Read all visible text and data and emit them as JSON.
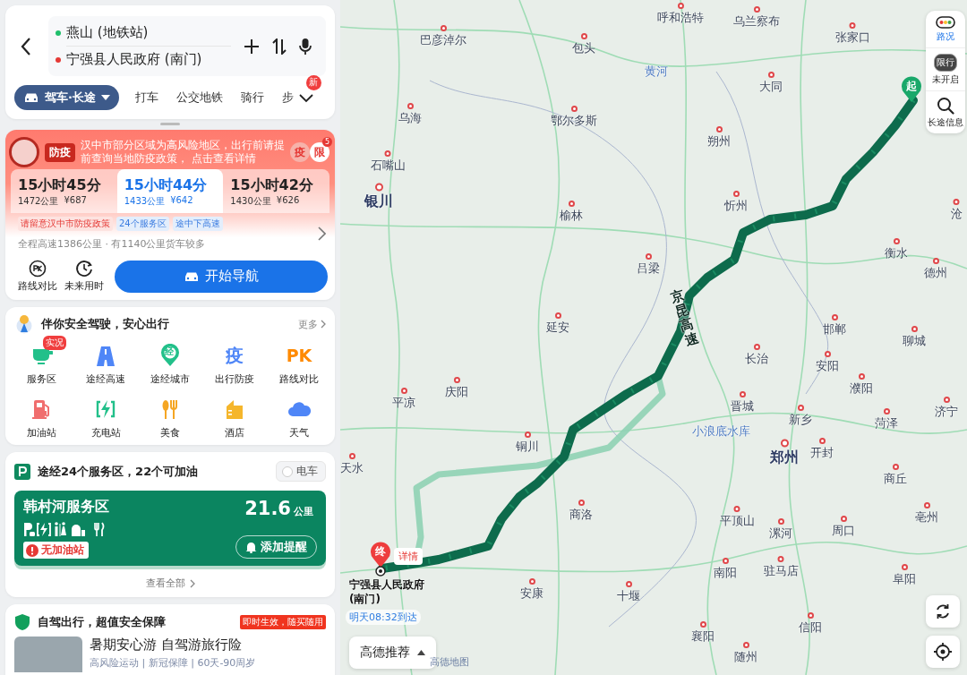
{
  "search": {
    "origin": "燕山 (地铁站)",
    "destination": "宁强县人民政府 (南门)"
  },
  "modes": [
    {
      "label": "驾车·长途",
      "selected": true
    },
    {
      "label": "打车",
      "selected": false
    },
    {
      "label": "公交地铁",
      "selected": false
    },
    {
      "label": "骑行",
      "selected": false
    },
    {
      "label": "步",
      "selected": false
    }
  ],
  "more_modes_badge": "新",
  "epidemic_banner": {
    "tag": "防疫",
    "message": "汉中市部分区域为高风险地区，出行前请提前查询当地防疫政策， 点击查看详情",
    "icons": [
      "疫",
      "限"
    ],
    "count": "5"
  },
  "routes": [
    {
      "duration": "15小时45分",
      "distance": "1472公里",
      "cost": "¥687",
      "selected": false
    },
    {
      "duration": "15小时44分",
      "distance": "1433公里",
      "cost": "¥642",
      "selected": true
    },
    {
      "duration": "15小时42分",
      "distance": "1430公里",
      "cost": "¥626",
      "selected": false
    }
  ],
  "route_tags": [
    {
      "text": "请留意汉中市防疫政策",
      "kind": "warning"
    },
    {
      "text": "24个服务区",
      "kind": "info"
    },
    {
      "text": "途中下高速",
      "kind": "info"
    }
  ],
  "route_summary": "全程高速1386公里 · 有1140公里货车较多",
  "actions": [
    {
      "label": "路线对比",
      "kind": "pk"
    },
    {
      "label": "未来用时",
      "kind": "clock"
    }
  ],
  "start_button": "开始导航",
  "safety": {
    "title": "伴你安全驾驶，安心出行",
    "more": "更多",
    "tools": [
      {
        "label": "服务区",
        "kind": "cup",
        "badge": "实况"
      },
      {
        "label": "途经高速",
        "kind": "road"
      },
      {
        "label": "途经城市",
        "kind": "pin",
        "glyph": "经"
      },
      {
        "label": "出行防疫",
        "kind": "glyph",
        "glyph": "疫"
      },
      {
        "label": "路线对比",
        "kind": "glyph",
        "glyph": "PK"
      },
      {
        "label": "加油站",
        "kind": "fuel"
      },
      {
        "label": "充电站",
        "kind": "charge"
      },
      {
        "label": "美食",
        "kind": "food"
      },
      {
        "label": "酒店",
        "kind": "hotel"
      },
      {
        "label": "天气",
        "kind": "cloud"
      }
    ]
  },
  "service_areas": {
    "title": "途经24个服务区，22个可加油",
    "ev_toggle": {
      "label": "电车",
      "checked": false
    },
    "card": {
      "name": "韩村河服务区",
      "distance": "21.6",
      "unit": "公里",
      "warning": "无加油站",
      "remind": "添加提醒"
    },
    "view_all": "查看全部"
  },
  "insurance": {
    "title": "自驾出行，超值安全保障",
    "badge": "即时生效，随买随用",
    "product": "暑期安心游 自驾游旅行险",
    "features": "高风险运动 | 新冠保障 | 60天-90周岁"
  },
  "map": {
    "places": [
      {
        "name": "呼和浩特",
        "kind": "city"
      },
      {
        "name": "乌兰察布",
        "kind": "city"
      },
      {
        "name": "张家口",
        "kind": "city"
      },
      {
        "name": "巴彦淖尔",
        "kind": "city"
      },
      {
        "name": "包头",
        "kind": "city"
      },
      {
        "name": "黄河",
        "kind": "water"
      },
      {
        "name": "大同",
        "kind": "city"
      },
      {
        "name": "乌海",
        "kind": "city"
      },
      {
        "name": "鄂尔多斯",
        "kind": "city"
      },
      {
        "name": "朔州",
        "kind": "city"
      },
      {
        "name": "石嘴山",
        "kind": "city"
      },
      {
        "name": "银川",
        "kind": "capital"
      },
      {
        "name": "忻州",
        "kind": "city"
      },
      {
        "name": "榆林",
        "kind": "city"
      },
      {
        "name": "沧",
        "kind": "city"
      },
      {
        "name": "吕梁",
        "kind": "city"
      },
      {
        "name": "衡水",
        "kind": "city"
      },
      {
        "name": "德州",
        "kind": "city"
      },
      {
        "name": "延安",
        "kind": "city"
      },
      {
        "name": "邯郸",
        "kind": "city"
      },
      {
        "name": "聊城",
        "kind": "city"
      },
      {
        "name": "长治",
        "kind": "city"
      },
      {
        "name": "安阳",
        "kind": "city"
      },
      {
        "name": "濮阳",
        "kind": "city"
      },
      {
        "name": "庆阳",
        "kind": "city"
      },
      {
        "name": "平凉",
        "kind": "city"
      },
      {
        "name": "晋城",
        "kind": "city"
      },
      {
        "name": "新乡",
        "kind": "city"
      },
      {
        "name": "菏泽",
        "kind": "city"
      },
      {
        "name": "济宁",
        "kind": "city"
      },
      {
        "name": "小浪底水库",
        "kind": "water"
      },
      {
        "name": "郑州",
        "kind": "capital"
      },
      {
        "name": "开封",
        "kind": "city"
      },
      {
        "name": "铜川",
        "kind": "city"
      },
      {
        "name": "天水",
        "kind": "city"
      },
      {
        "name": "商丘",
        "kind": "city"
      },
      {
        "name": "商洛",
        "kind": "city"
      },
      {
        "name": "平顶山",
        "kind": "city"
      },
      {
        "name": "漯河",
        "kind": "city"
      },
      {
        "name": "周口",
        "kind": "city"
      },
      {
        "name": "亳州",
        "kind": "city"
      },
      {
        "name": "安康",
        "kind": "city"
      },
      {
        "name": "十堰",
        "kind": "city"
      },
      {
        "name": "南阳",
        "kind": "city"
      },
      {
        "name": "驻马店",
        "kind": "city"
      },
      {
        "name": "阜阳",
        "kind": "city"
      },
      {
        "name": "襄阳",
        "kind": "city"
      },
      {
        "name": "随州",
        "kind": "city"
      },
      {
        "name": "信阳",
        "kind": "city"
      }
    ],
    "highway": "京昆高速",
    "start_pin": "起",
    "end_pin": "终",
    "end_detail": "详情",
    "end_name": "宁强县人民政府(南门)",
    "arrival": "明天08:32到达",
    "route_option": "高德推荐",
    "provider": "高德地图"
  },
  "map_controls": [
    {
      "label": "路况",
      "kind": "traffic",
      "on": true
    },
    {
      "label": "未开启",
      "kind": "restriction",
      "badge": "限行",
      "on": false
    },
    {
      "label": "长途信息",
      "kind": "search",
      "on": false
    }
  ]
}
